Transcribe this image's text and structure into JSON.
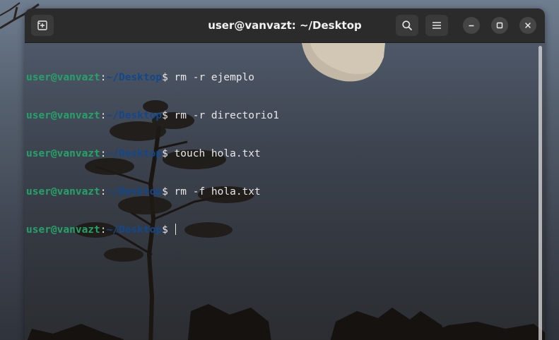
{
  "window": {
    "title": "user@vanvazt: ~/Desktop"
  },
  "headerbar": {
    "buttons": {
      "new_tab": "new-tab-icon",
      "search": "search-icon",
      "menu": "hamburger-menu-icon",
      "minimize": "minimize-icon",
      "maximize": "maximize-icon",
      "close": "close-icon"
    }
  },
  "prompt": {
    "user_host": "user@vanvazt",
    "colon": ":",
    "path": "~/Desktop",
    "dollar": "$ "
  },
  "terminal": {
    "lines": [
      {
        "command": "rm -r ejemplo"
      },
      {
        "command": "rm -r directorio1"
      },
      {
        "command": "touch hola.txt"
      },
      {
        "command": "rm -f hola.txt"
      },
      {
        "command": ""
      }
    ]
  },
  "colors": {
    "prompt_user": "#26a269",
    "prompt_path": "#12488b",
    "text": "#e8e8e8",
    "headerbar": "#2b2b2b"
  }
}
